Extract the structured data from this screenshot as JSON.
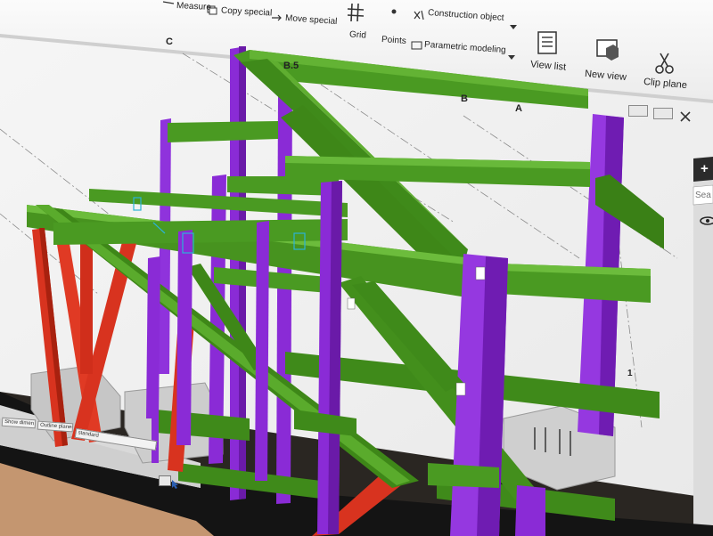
{
  "ribbon": {
    "measure": "Measure",
    "copy_special": "Copy special",
    "move_special": "Move special",
    "grid": "Grid",
    "points": "Points",
    "construction_object": "Construction object",
    "parametric_modeling": "Parametric modeling",
    "view_list": "View list",
    "new_view": "New view",
    "clip_plane": "Clip plane"
  },
  "grid_labels": {
    "c": "C",
    "b5": "B.5",
    "b": "B",
    "a": "A",
    "one": "1"
  },
  "side_panel": {
    "plus": "+",
    "search_placeholder": "Sea"
  },
  "status_bar": {
    "select_dropdown": "Show dimen",
    "plane_dropdown": "Outline planes",
    "level_dropdown": "standard"
  },
  "colors": {
    "beam_green": "#3f8a1a",
    "column_purple": "#8a2bd6",
    "brace_red": "#d8331f",
    "viewport_bg": "#f3f3f3",
    "ribbon_bg": "#f5f5f5"
  }
}
